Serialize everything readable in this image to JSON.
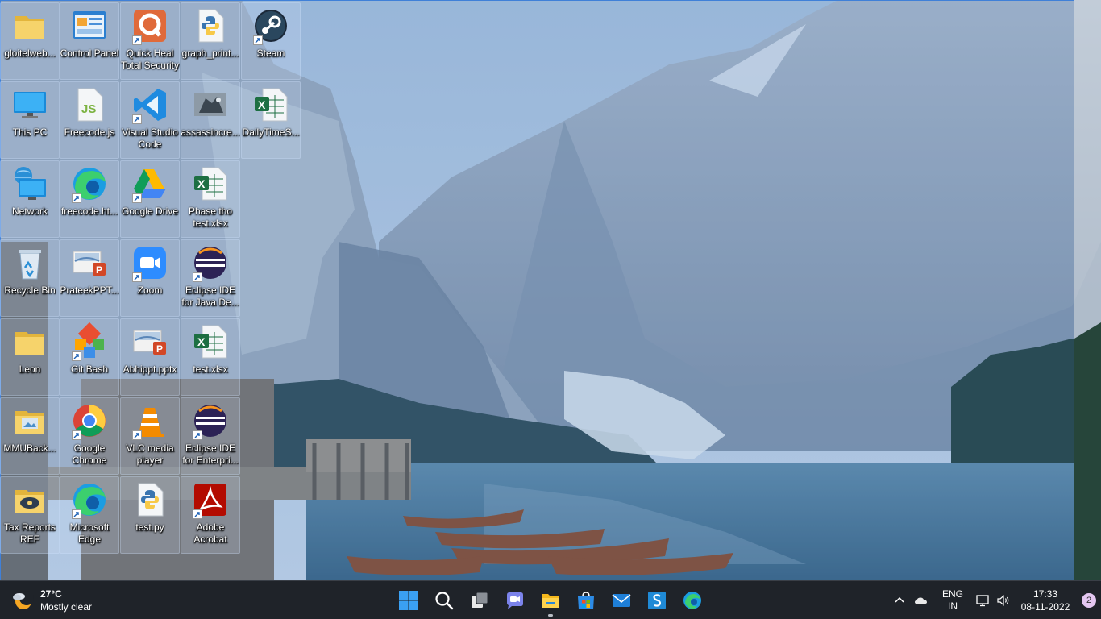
{
  "desktop": {
    "icons": [
      {
        "label": "gloitelweb...",
        "icon": "folder-icon",
        "selected": true
      },
      {
        "label": "Control Panel",
        "icon": "control-panel-icon",
        "selected": true
      },
      {
        "label": "Quick Heal Total Security",
        "icon": "quick-heal-icon",
        "selected": true
      },
      {
        "label": "graph_print...",
        "icon": "python-file-icon",
        "selected": true
      },
      {
        "label": "Steam",
        "icon": "steam-icon",
        "selected": true
      },
      {
        "label": "This PC",
        "icon": "this-pc-icon",
        "selected": true
      },
      {
        "label": "Freecode.js",
        "icon": "js-file-icon",
        "selected": true
      },
      {
        "label": "Visual Studio Code",
        "icon": "vscode-icon",
        "selected": true
      },
      {
        "label": "assassincre...",
        "icon": "game-icon",
        "selected": true
      },
      {
        "label": "DailyTimeS...",
        "icon": "excel-file-icon",
        "selected": true
      },
      {
        "label": "Network",
        "icon": "network-icon",
        "selected": true
      },
      {
        "label": "freecode.ht...",
        "icon": "edge-html-icon",
        "selected": true
      },
      {
        "label": "Google Drive",
        "icon": "google-drive-icon",
        "selected": true
      },
      {
        "label": "Phase tho test.xlsx",
        "icon": "excel-file-icon",
        "selected": true
      },
      {
        "label": "Recycle Bin",
        "icon": "recycle-bin-icon",
        "selected": true
      },
      {
        "label": "PrateekPPT...",
        "icon": "powerpoint-file-icon",
        "selected": true
      },
      {
        "label": "Zoom",
        "icon": "zoom-icon",
        "selected": true
      },
      {
        "label": "Eclipse IDE for Java De...",
        "icon": "eclipse-icon",
        "selected": true
      },
      {
        "label": "Leon",
        "icon": "folder-icon",
        "selected": true
      },
      {
        "label": "Git Bash",
        "icon": "git-bash-icon",
        "selected": true
      },
      {
        "label": "Abhippt.pptx",
        "icon": "powerpoint-file-icon",
        "selected": true
      },
      {
        "label": "test.xlsx",
        "icon": "excel-file-icon",
        "selected": true
      },
      {
        "label": "MMUBack...",
        "icon": "folder-image-icon",
        "selected": true
      },
      {
        "label": "Google Chrome",
        "icon": "chrome-icon",
        "selected": true
      },
      {
        "label": "VLC media player",
        "icon": "vlc-icon",
        "selected": true
      },
      {
        "label": "Eclipse IDE for Enterpri...",
        "icon": "eclipse-icon",
        "selected": true
      },
      {
        "label": "Tax Reports REF",
        "icon": "folder-disc-icon",
        "selected": true
      },
      {
        "label": "Microsoft Edge",
        "icon": "edge-icon",
        "selected": true
      },
      {
        "label": "test.py",
        "icon": "python-file-icon",
        "selected": true
      },
      {
        "label": "Adobe Acrobat",
        "icon": "acrobat-icon",
        "selected": true
      }
    ]
  },
  "taskbar": {
    "weather": {
      "temperature": "27°C",
      "condition": "Mostly clear",
      "icon": "weather-moon-cloud-icon"
    },
    "apps": [
      {
        "name": "start",
        "icon": "windows-start-icon",
        "running": false
      },
      {
        "name": "search",
        "icon": "search-icon",
        "running": false
      },
      {
        "name": "task-view",
        "icon": "task-view-icon",
        "running": false
      },
      {
        "name": "chat",
        "icon": "teams-chat-icon",
        "running": false
      },
      {
        "name": "file-explorer",
        "icon": "file-explorer-icon",
        "running": true
      },
      {
        "name": "microsoft-store",
        "icon": "store-icon",
        "running": false
      },
      {
        "name": "mail",
        "icon": "mail-icon",
        "running": false
      },
      {
        "name": "azure-data-studio",
        "icon": "app-s-icon",
        "running": false
      },
      {
        "name": "edge",
        "icon": "edge-icon",
        "running": false
      }
    ],
    "tray": {
      "language_line1": "ENG",
      "language_line2": "IN",
      "time": "17:33",
      "date": "08-11-2022",
      "notifications": "2"
    }
  },
  "colors": {
    "taskbar_bg": "#1f2329",
    "selection": "#3f80d8"
  }
}
